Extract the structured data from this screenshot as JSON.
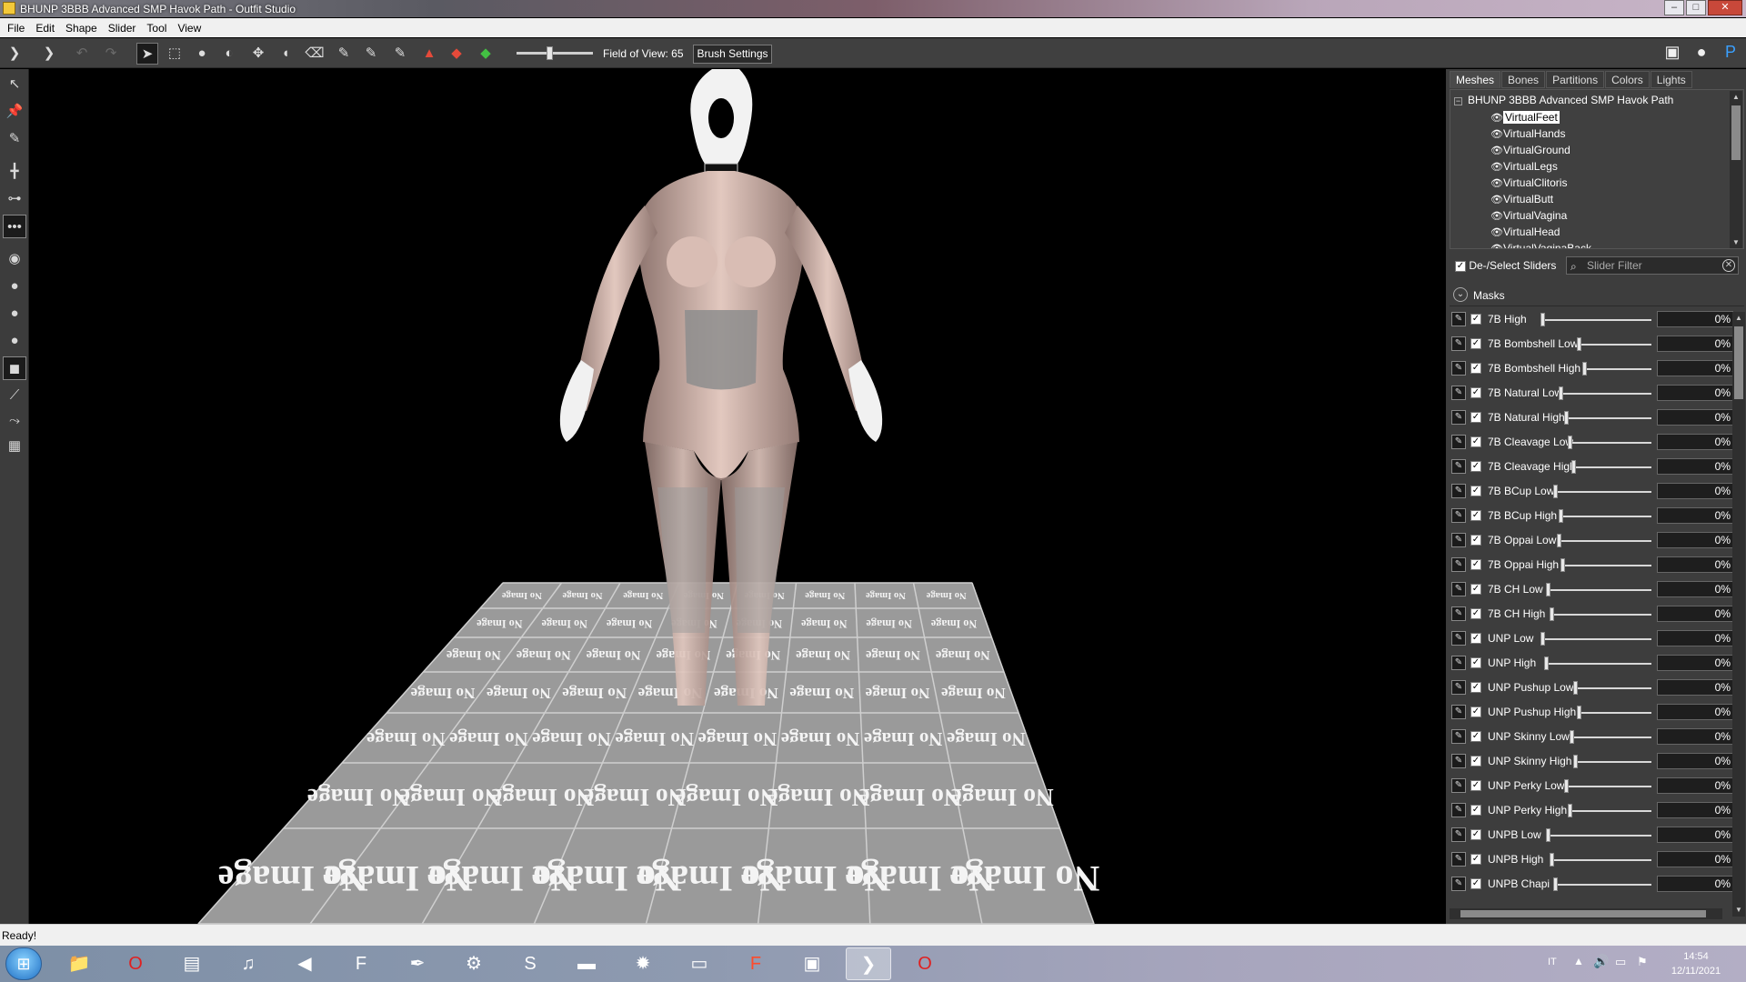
{
  "window": {
    "title": "BHUNP 3BBB Advanced SMP Havok Path - Outfit Studio",
    "minimize": "–",
    "maximize": "□",
    "close": "✕"
  },
  "menu": [
    "File",
    "Edit",
    "Shape",
    "Slider",
    "Tool",
    "View"
  ],
  "toolbar": {
    "fov_label": "Field of View: 65",
    "brush_settings": "Brush Settings"
  },
  "tabs": [
    "Meshes",
    "Bones",
    "Partitions",
    "Colors",
    "Lights"
  ],
  "tree": {
    "root": "BHUNP 3BBB Advanced SMP Havok Path",
    "items": [
      "VirtualFeet",
      "VirtualHands",
      "VirtualGround",
      "VirtualLegs",
      "VirtualClitoris",
      "VirtualButt",
      "VirtualVagina",
      "VirtualHead",
      "VirtualVaginaBack"
    ]
  },
  "slider_header": {
    "deselect_label": "De-/Select Sliders",
    "filter_placeholder": "Slider Filter"
  },
  "masks_label": "Masks",
  "sliders": [
    {
      "name": "7B High",
      "value": "0%",
      "fill": 0.0
    },
    {
      "name": "7B Bombshell Low",
      "value": "0%",
      "fill": 0.0
    },
    {
      "name": "7B Bombshell High",
      "value": "0%",
      "fill": 0.0
    },
    {
      "name": "7B Natural Low",
      "value": "0%",
      "fill": 0.0
    },
    {
      "name": "7B Natural High",
      "value": "0%",
      "fill": 0.0
    },
    {
      "name": "7B Cleavage Low",
      "value": "0%",
      "fill": 0.0
    },
    {
      "name": "7B Cleavage High",
      "value": "0%",
      "fill": 0.0
    },
    {
      "name": "7B BCup Low",
      "value": "0%",
      "fill": 0.0
    },
    {
      "name": "7B BCup High",
      "value": "0%",
      "fill": 0.0
    },
    {
      "name": "7B Oppai Low",
      "value": "0%",
      "fill": 0.0
    },
    {
      "name": "7B Oppai High",
      "value": "0%",
      "fill": 0.0
    },
    {
      "name": "7B CH Low",
      "value": "0%",
      "fill": 0.0
    },
    {
      "name": "7B CH High",
      "value": "0%",
      "fill": 0.0
    },
    {
      "name": "UNP Low",
      "value": "0%",
      "fill": 0.0
    },
    {
      "name": "UNP High",
      "value": "0%",
      "fill": 0.0
    },
    {
      "name": "UNP Pushup Low",
      "value": "0%",
      "fill": 0.0
    },
    {
      "name": "UNP Pushup High",
      "value": "0%",
      "fill": 0.0
    },
    {
      "name": "UNP Skinny Low",
      "value": "0%",
      "fill": 0.0
    },
    {
      "name": "UNP Skinny High",
      "value": "0%",
      "fill": 0.0
    },
    {
      "name": "UNP Perky Low",
      "value": "0%",
      "fill": 0.0
    },
    {
      "name": "UNP Perky High",
      "value": "0%",
      "fill": 0.0
    },
    {
      "name": "UNPB Low",
      "value": "0%",
      "fill": 0.0
    },
    {
      "name": "UNPB High",
      "value": "0%",
      "fill": 0.0
    },
    {
      "name": "UNPB Chapi",
      "value": "0%",
      "fill": 0.0
    }
  ],
  "status": "Ready!",
  "floor_tile_text": "No Image",
  "taskbar": {
    "time": "14:54",
    "date": "12/11/2021",
    "lang": "IT",
    "icons": [
      "folder-icon",
      "opera-icon",
      "media-icon",
      "itunes-icon",
      "volume-app-icon",
      "ffdec-icon",
      "feather-icon",
      "tools-icon",
      "skype-icon",
      "nmm-icon",
      "spider-icon",
      "window-icon",
      "fallout-icon",
      "bae-icon",
      "outfit-studio-icon",
      "opera-icon"
    ]
  },
  "colors": {
    "toolbar_bg": "#404040",
    "panel_bg": "#3d3d3d",
    "viewport_bg": "#000000",
    "floor": "#9a9a9a"
  }
}
